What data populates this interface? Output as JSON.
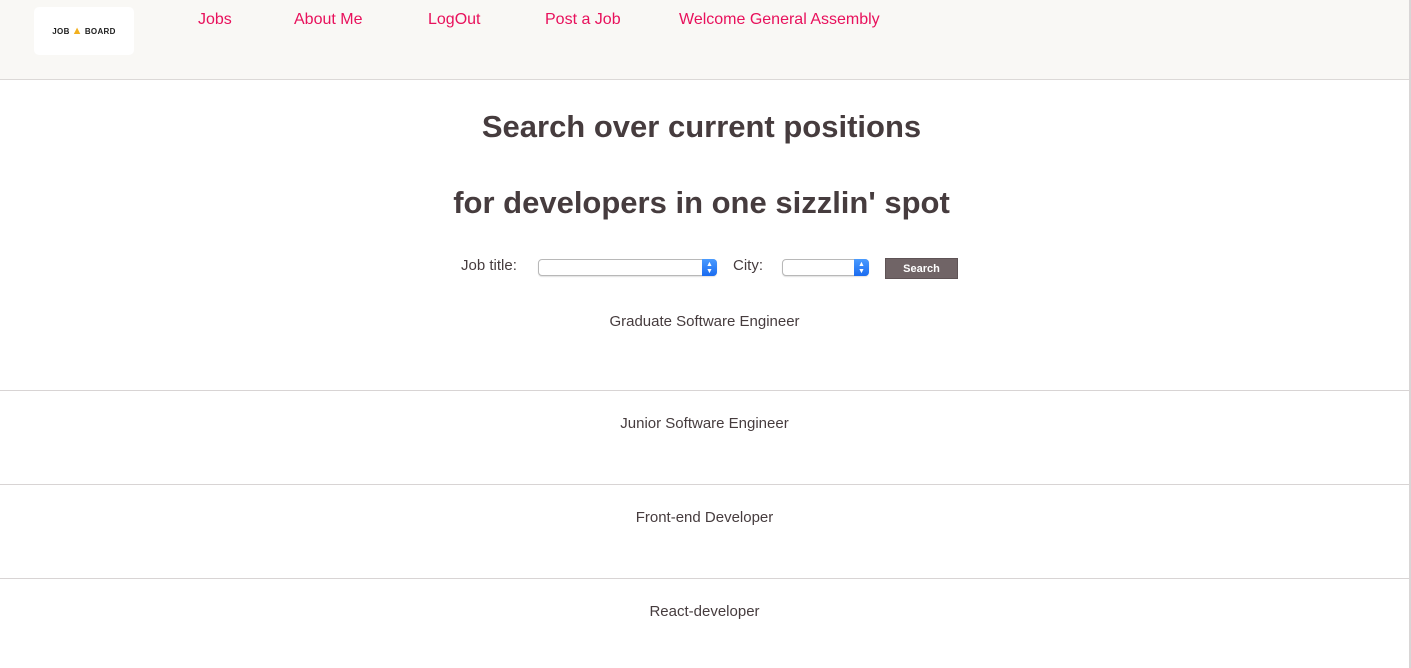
{
  "logo": {
    "left_text": "JOB",
    "right_text": "BOARD",
    "icon": "megaphone-icon"
  },
  "nav": {
    "items": [
      {
        "label": "Jobs"
      },
      {
        "label": "About Me"
      },
      {
        "label": "LogOut"
      },
      {
        "label": "Post a Job"
      },
      {
        "label": "Welcome General Assembly"
      }
    ]
  },
  "hero": {
    "line1": "Search over current positions",
    "line2": "for developers in one sizzlin' spot"
  },
  "search": {
    "job_title_label": "Job title:",
    "job_title_value": "",
    "city_label": "City:",
    "city_value": "",
    "button_label": "Search"
  },
  "jobs": [
    {
      "title": "Graduate Software Engineer"
    },
    {
      "title": "Junior Software Engineer"
    },
    {
      "title": "Front-end Developer"
    },
    {
      "title": "React-developer"
    }
  ],
  "colors": {
    "nav_link": "#e8115c",
    "header_bg": "#f9f8f5",
    "button_bg": "#706466",
    "text": "#463c3e"
  }
}
